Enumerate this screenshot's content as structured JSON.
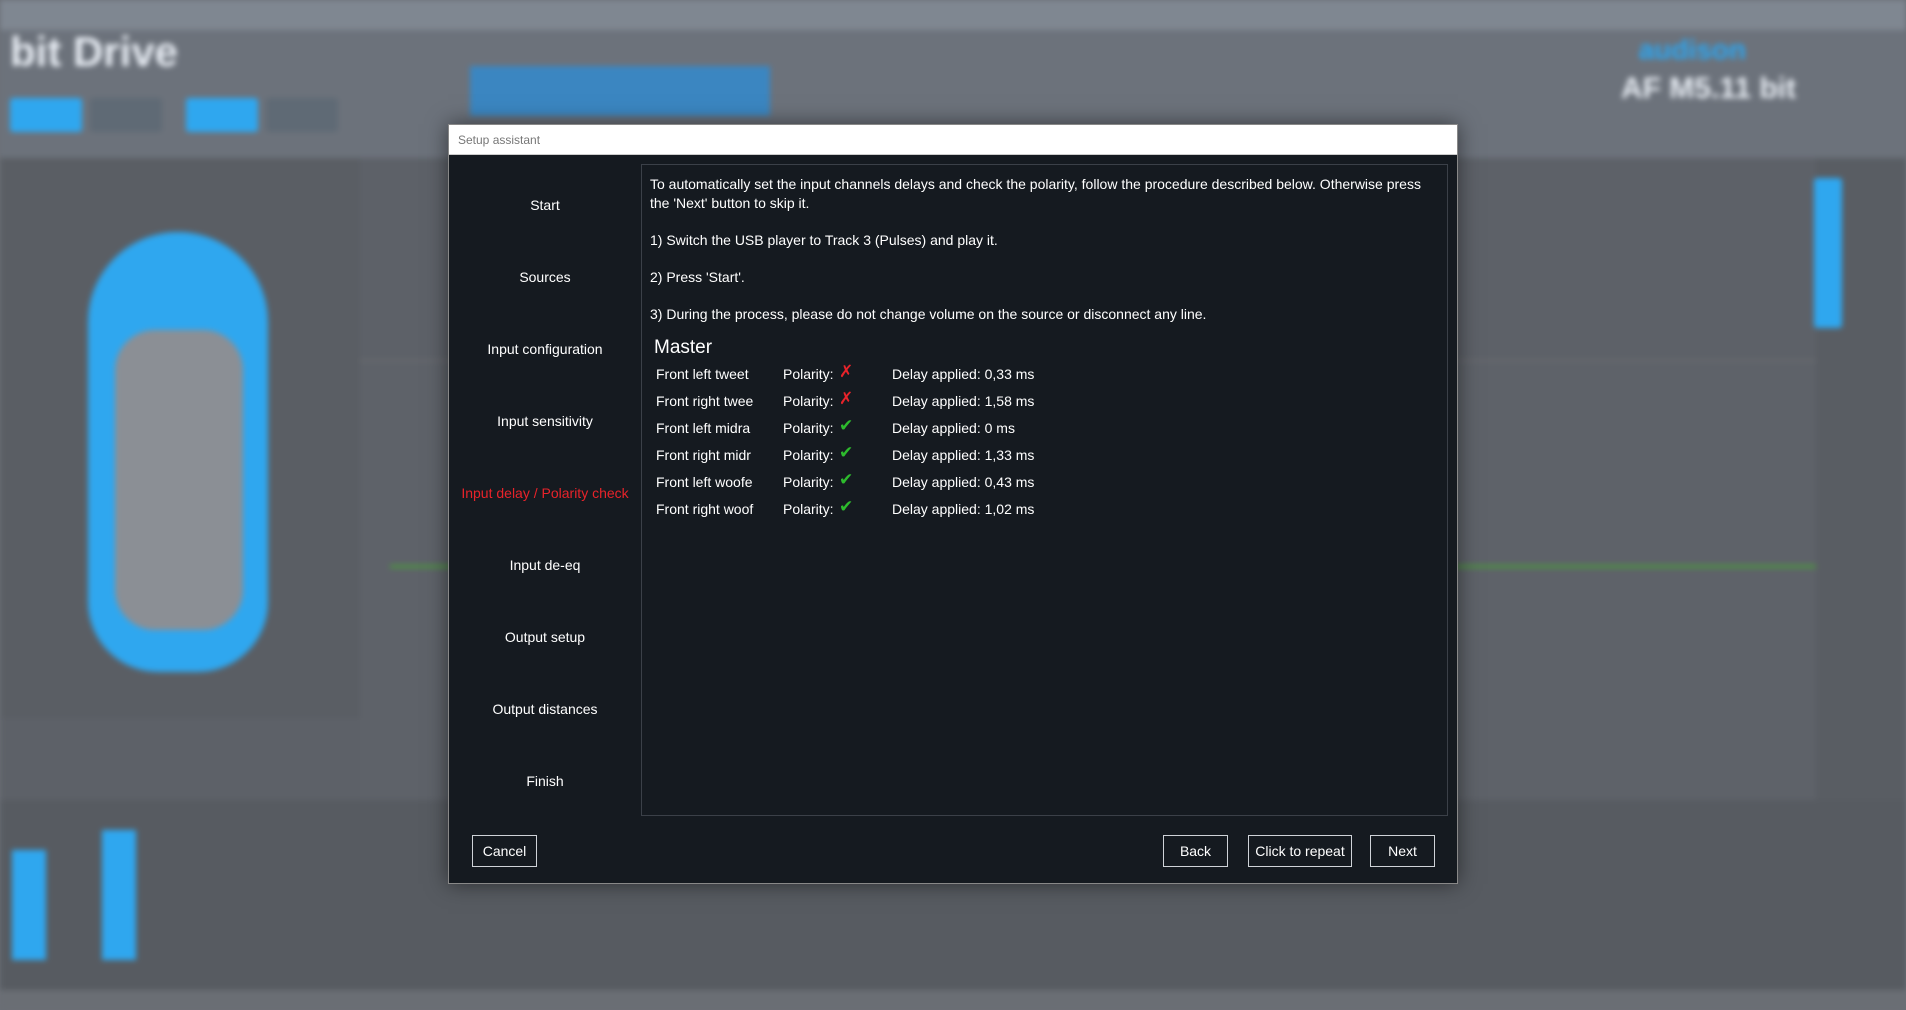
{
  "background_app": {
    "logo": "bit Drive",
    "brand": "audison",
    "model": "AF M5.11 bit"
  },
  "dialog": {
    "title": "Setup assistant",
    "steps": [
      {
        "label": "Start",
        "active": false
      },
      {
        "label": "Sources",
        "active": false
      },
      {
        "label": "Input configuration",
        "active": false
      },
      {
        "label": "Input sensitivity",
        "active": false
      },
      {
        "label": "Input delay / Polarity check",
        "active": true
      },
      {
        "label": "Input de-eq",
        "active": false
      },
      {
        "label": "Output setup",
        "active": false
      },
      {
        "label": "Output distances",
        "active": false
      },
      {
        "label": "Finish",
        "active": false
      }
    ],
    "content": {
      "intro": "To automatically set the input channels delays and check the polarity, follow the procedure described below. Otherwise press the 'Next' button to skip it.",
      "step1": "1) Switch the USB player to Track 3 (Pulses) and play it.",
      "step2": "2) Press 'Start'.",
      "step3": "3) During the process, please do not change volume on the source or disconnect any line.",
      "section_title": "Master",
      "polarity_label": "Polarity:",
      "channels": [
        {
          "name": "Front left tweet",
          "polarity_ok": false,
          "polarity_icon": "✗",
          "delay": "Delay applied: 0,33 ms"
        },
        {
          "name": "Front right twee",
          "polarity_ok": false,
          "polarity_icon": "✗",
          "delay": "Delay applied: 1,58 ms"
        },
        {
          "name": "Front left midra",
          "polarity_ok": true,
          "polarity_icon": "✔",
          "delay": "Delay applied: 0 ms"
        },
        {
          "name": "Front right midr",
          "polarity_ok": true,
          "polarity_icon": "✔",
          "delay": "Delay applied: 1,33 ms"
        },
        {
          "name": "Front left woofe",
          "polarity_ok": true,
          "polarity_icon": "✔",
          "delay": "Delay applied: 0,43 ms"
        },
        {
          "name": "Front right woof",
          "polarity_ok": true,
          "polarity_icon": "✔",
          "delay": "Delay applied: 1,02 ms"
        }
      ]
    },
    "buttons": {
      "cancel": "Cancel",
      "back": "Back",
      "repeat": "Click to repeat",
      "next": "Next"
    },
    "colors": {
      "active_step": "#e8232a",
      "polarity_bad": "#e8232a",
      "polarity_good": "#2dbb2d",
      "dialog_bg": "#151a20"
    }
  }
}
